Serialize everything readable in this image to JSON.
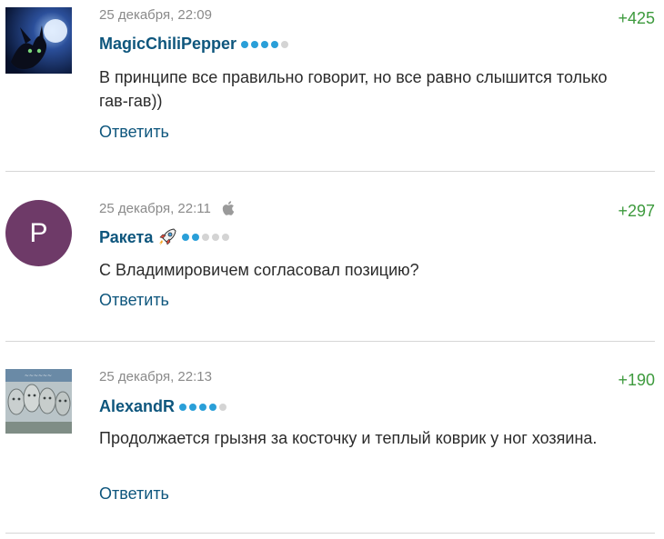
{
  "comments": [
    {
      "timestamp": "25 декабря, 22:09",
      "score": "+425",
      "author": "MagicChiliPepper",
      "rating_level": 4,
      "rating_max": 5,
      "text": "В принципе все правильно говорит, но все равно слышится только гав-гав))",
      "reply_label": "Ответить",
      "avatar": "night-fury-dragon-moon-image"
    },
    {
      "timestamp": "25 декабря, 22:11",
      "platform_icon": "apple-icon",
      "score": "+297",
      "author": "Ракета",
      "author_badge_icon": "rocket-icon",
      "rating_level": 2,
      "rating_max": 5,
      "text": "С Владимировичем согласовал позицию?",
      "reply_label": "Ответить",
      "avatar_letter": "P",
      "avatar_color": "#6e3a68"
    },
    {
      "timestamp": "25 декабря, 22:13",
      "score": "+190",
      "author": "AlexandR",
      "rating_level": 4,
      "rating_max": 5,
      "text": "Продолжается грызня за косточку и теплый коврик у ног хозяина.",
      "reply_label": "Ответить",
      "avatar": "mount-rushmore-band-image"
    }
  ],
  "colors": {
    "author": "#0e567d",
    "score": "#3d9a3d",
    "rating_on": "#2a9fd8",
    "rating_off": "#d4d4d4",
    "meta": "#8a8a8a"
  }
}
